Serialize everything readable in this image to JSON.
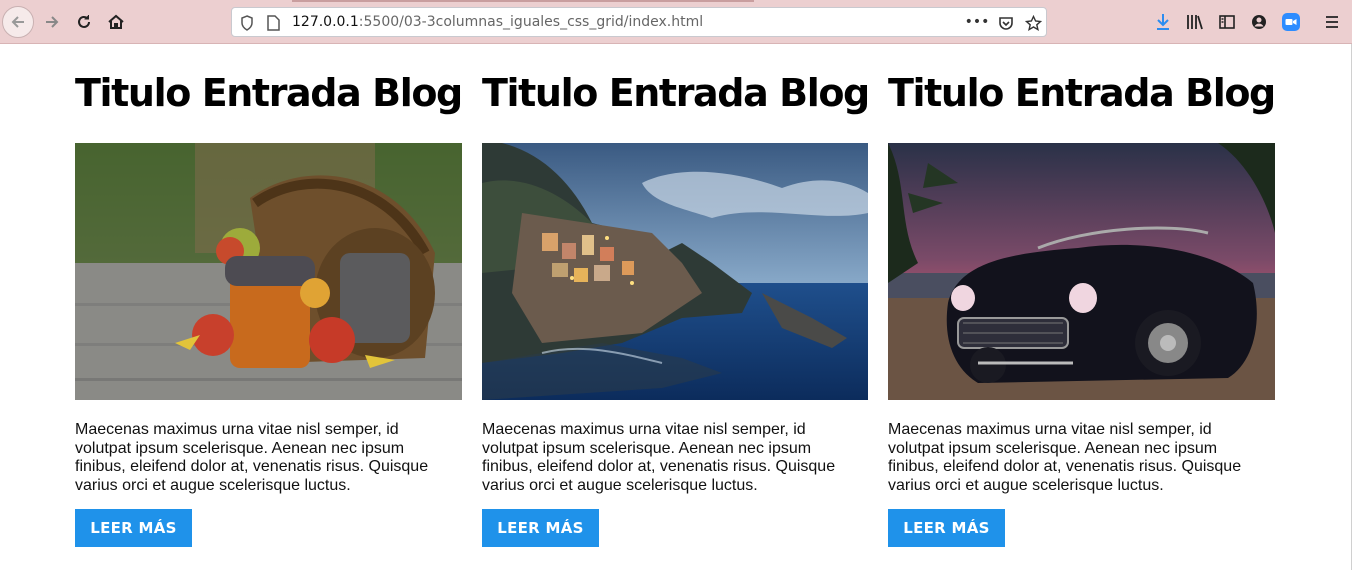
{
  "browser": {
    "url_host": "127.0.0.1",
    "url_path": ":5500/03-3columnas_iguales_css_grid/index.html",
    "more_label": "•••"
  },
  "cards": [
    {
      "title": "Titulo Entrada Blog",
      "image": "basket-with-apples-and-jam-jar",
      "text": "Maecenas maximus urna vitae nisl semper, id volutpat ipsum scelerisque. Aenean nec ipsum finibus, eleifend dolor at, venenatis risus. Quisque varius orci et augue scelerisque luctus.",
      "button": "LEER MÁS"
    },
    {
      "title": "Titulo Entrada Blog",
      "image": "coastal-cliff-village-at-dusk",
      "text": "Maecenas maximus urna vitae nisl semper, id volutpat ipsum scelerisque. Aenean nec ipsum finibus, eleifend dolor at, venenatis risus. Quisque varius orci et augue scelerisque luctus.",
      "button": "LEER MÁS"
    },
    {
      "title": "Titulo Entrada Blog",
      "image": "vintage-convertible-car-at-sunset",
      "text": "Maecenas maximus urna vitae nisl semper, id volutpat ipsum scelerisque. Aenean nec ipsum finibus, eleifend dolor at, venenatis risus. Quisque varius orci et augue scelerisque luctus.",
      "button": "LEER MÁS"
    }
  ],
  "colors": {
    "toolbar": "#eccfd0",
    "button": "#1f92ea",
    "download_icon": "#2b8cf0"
  }
}
